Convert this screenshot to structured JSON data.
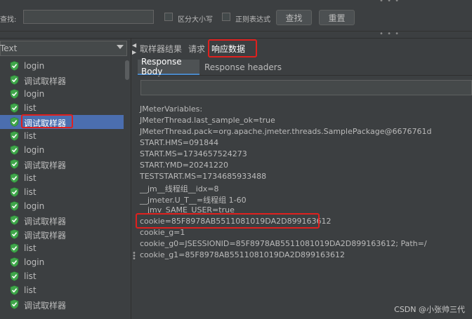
{
  "search_bar": {
    "label": "查找:",
    "input_value": "",
    "case_sensitive_label": "区分大小写",
    "regex_label": "正则表达式",
    "find_button": "查找",
    "reset_button": "重置",
    "dots_top": "• • •",
    "dots_mid": "• • •"
  },
  "left_panel": {
    "renderer_select_value": "Text",
    "tree_items": [
      {
        "label": "login",
        "status": "success"
      },
      {
        "label": "调试取样器",
        "status": "success"
      },
      {
        "label": "login",
        "status": "success"
      },
      {
        "label": "list",
        "status": "success"
      },
      {
        "label": "调试取样器",
        "status": "success",
        "selected": true
      },
      {
        "label": "list",
        "status": "success"
      },
      {
        "label": "login",
        "status": "success"
      },
      {
        "label": "调试取样器",
        "status": "success"
      },
      {
        "label": "list",
        "status": "success"
      },
      {
        "label": "list",
        "status": "success"
      },
      {
        "label": "login",
        "status": "success"
      },
      {
        "label": "调试取样器",
        "status": "success"
      },
      {
        "label": "调试取样器",
        "status": "success"
      },
      {
        "label": "list",
        "status": "success"
      },
      {
        "label": "login",
        "status": "success"
      },
      {
        "label": "list",
        "status": "success"
      },
      {
        "label": "list",
        "status": "success"
      },
      {
        "label": "调试取样器",
        "status": "success"
      }
    ]
  },
  "right_panel": {
    "tabs": [
      "取样器结果",
      "请求",
      "响应数据"
    ],
    "active_tab": "响应数据",
    "subtabs": [
      "Response Body",
      "Response headers"
    ],
    "active_subtab": "Response Body",
    "response_lines": [
      "JMeterVariables:",
      "JMeterThread.last_sample_ok=true",
      "JMeterThread.pack=org.apache.jmeter.threads.SamplePackage@6676761d",
      "START.HMS=091844",
      "START.MS=1734657524273",
      "START.YMD=20241220",
      "TESTSTART.MS=1734685933488",
      "__jm__线程组__idx=8",
      "__jmeter.U_T__=线程组 1-60",
      "__jmv_SAME_USER=true",
      "cookie=85F8978AB5511081019DA2D899163612",
      "cookie_g=1",
      "cookie_g0=JSESSIONID=85F8978AB5511081019DA2D899163612; Path=/",
      "cookie_g1=85F8978AB5511081019DA2D899163612"
    ]
  },
  "watermark": "CSDN @小张帅三代",
  "colors": {
    "background": "#3c3f41",
    "selection": "#4b6eaf",
    "success_icon": "#3fa64a",
    "annotation_red": "#e0201e",
    "tab_accent": "#4a88c7"
  }
}
